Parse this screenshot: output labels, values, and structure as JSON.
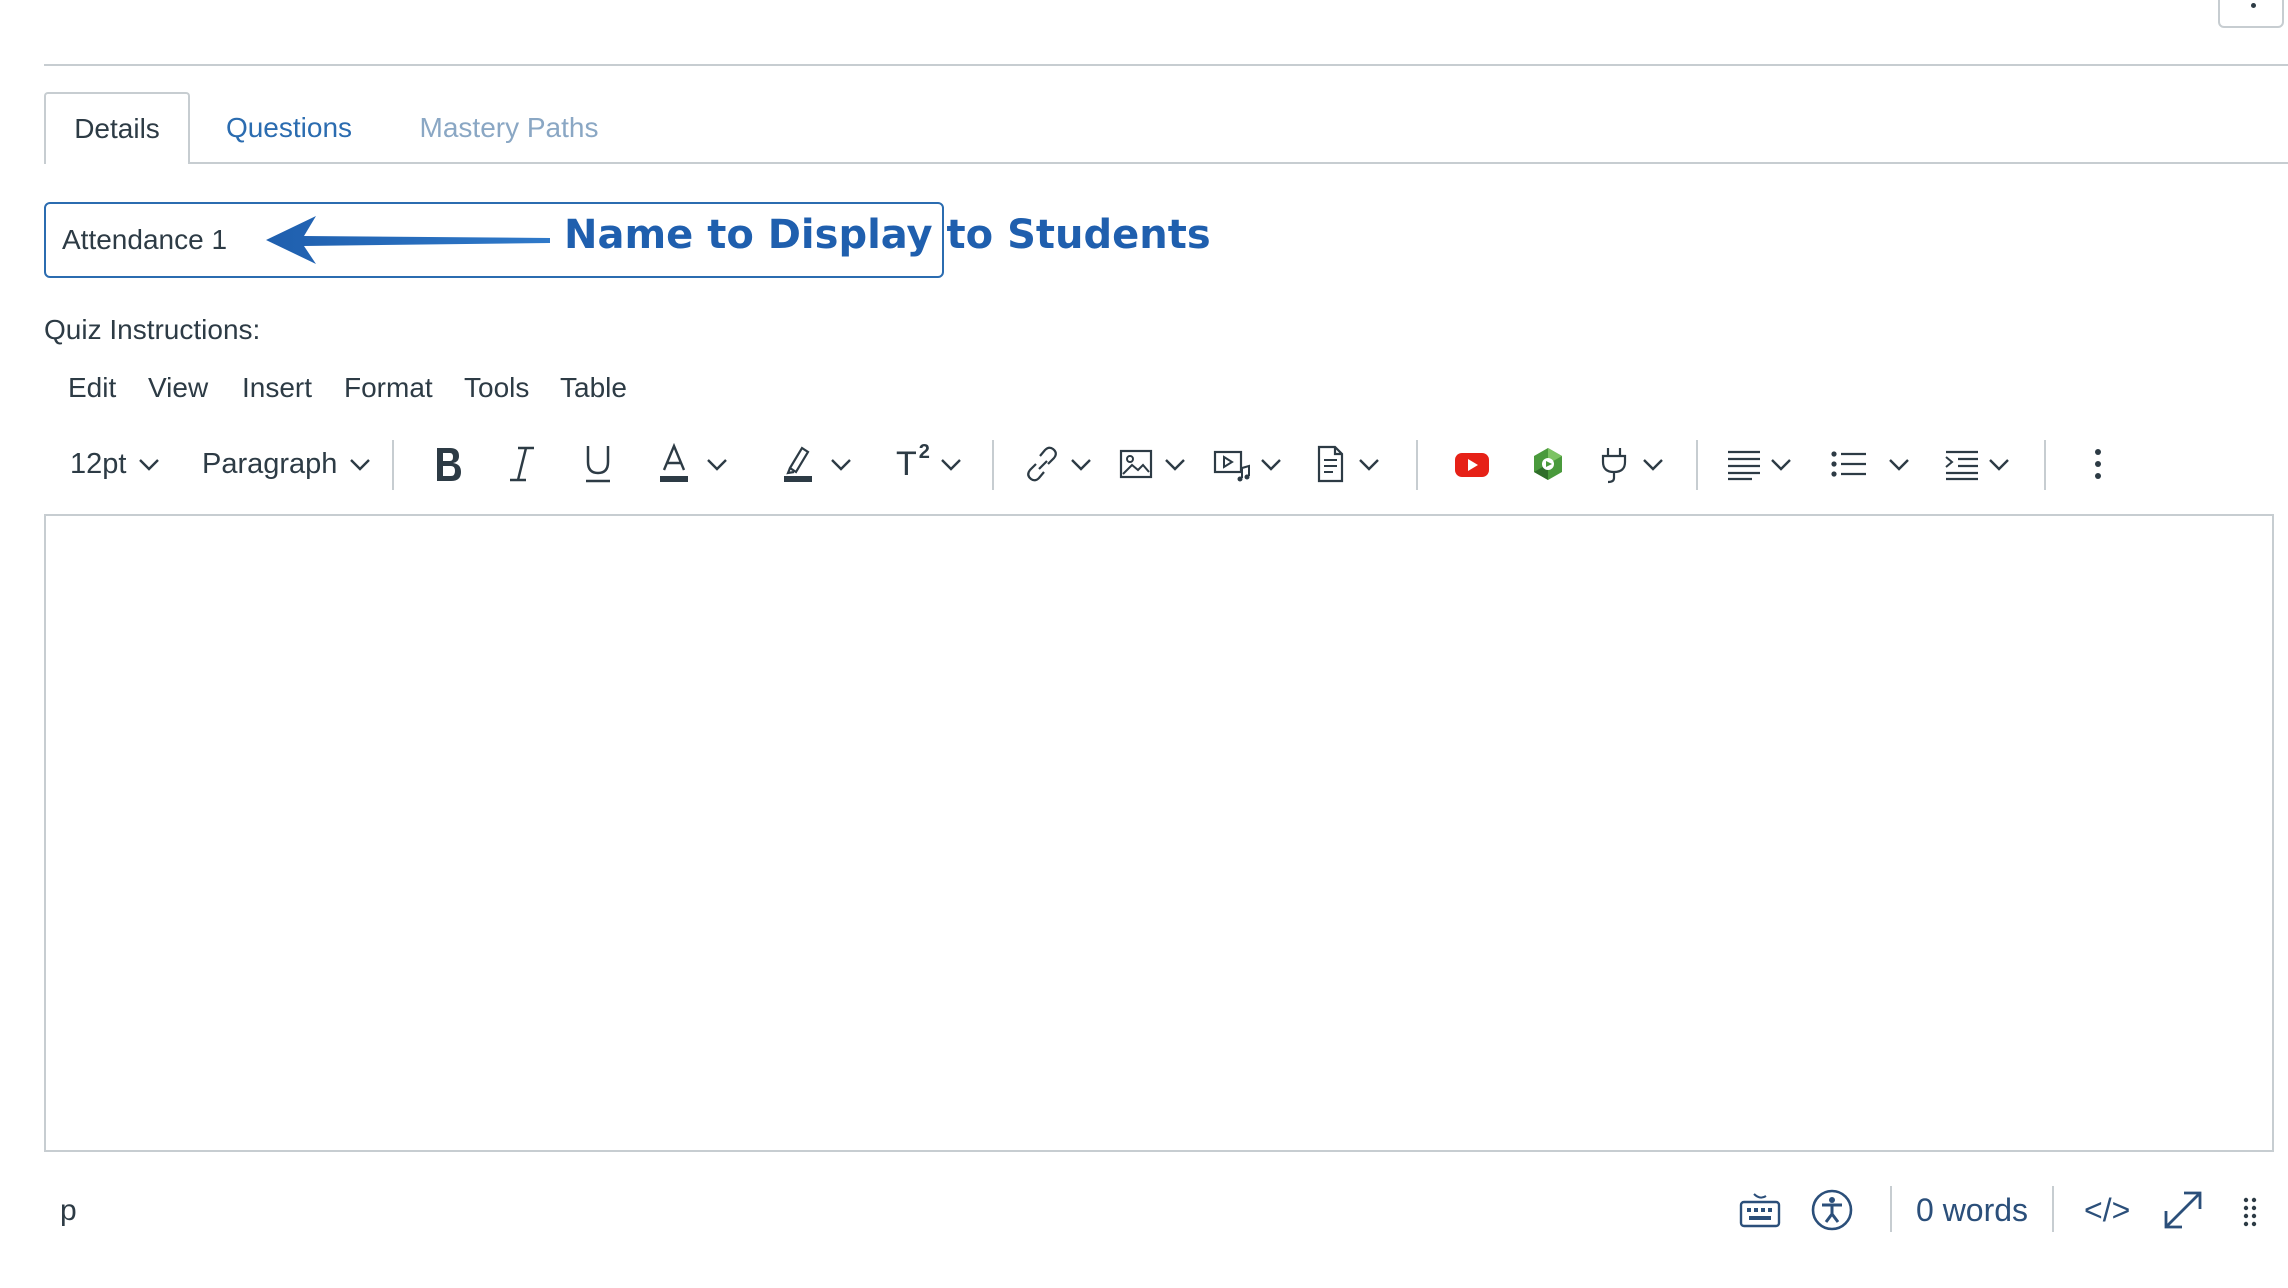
{
  "tabs": [
    {
      "label": "Details",
      "state": "active"
    },
    {
      "label": "Questions",
      "state": "inactive"
    },
    {
      "label": "Mastery Paths",
      "state": "disabled"
    }
  ],
  "title_input": {
    "value": "Attendance 1"
  },
  "annotation": {
    "text": "Name to Display to Students",
    "color": "#1f5fae"
  },
  "instructions_label": "Quiz Instructions:",
  "menubar": [
    "Edit",
    "View",
    "Insert",
    "Format",
    "Tools",
    "Table"
  ],
  "toolbar": {
    "font_size": "12pt",
    "block_format": "Paragraph",
    "superscript_label": "T",
    "superscript_exp": "2",
    "icons": [
      "bold-icon",
      "italic-icon",
      "underline-icon",
      "text-color-icon",
      "highlight-icon",
      "superscript-icon",
      "link-icon",
      "image-icon",
      "media-icon",
      "document-icon",
      "youtube-icon",
      "app-icon",
      "plugin-icon",
      "align-icon",
      "list-icon",
      "indent-icon",
      "more-icon"
    ]
  },
  "status_bar": {
    "path": "p",
    "word_count": "0 words",
    "html_toggle": "</>"
  },
  "colors": {
    "link": "#2b6cb0",
    "border": "#c7cdd1",
    "youtube": "#e62117",
    "text": "#2d3b45"
  }
}
